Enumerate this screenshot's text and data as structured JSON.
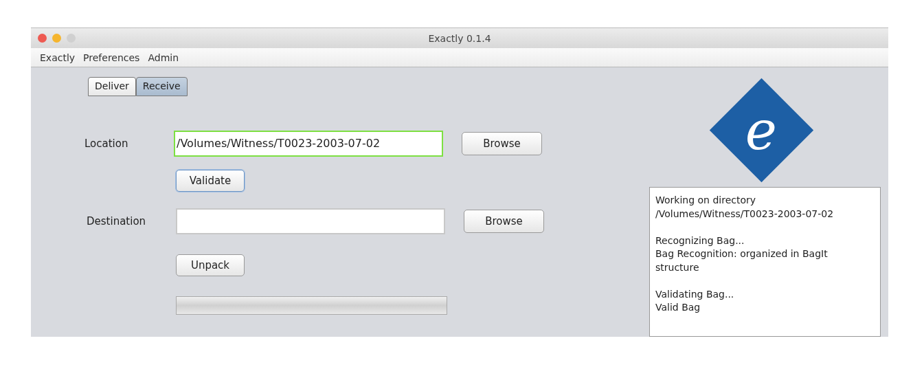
{
  "window": {
    "title": "Exactly 0.1.4"
  },
  "menu": [
    "Exactly",
    "Preferences",
    "Admin"
  ],
  "tabs": [
    {
      "label": "Deliver",
      "selected": false
    },
    {
      "label": "Receive",
      "selected": true
    }
  ],
  "rows": [
    {
      "kind": "field",
      "label": "Location",
      "value": "/Volumes/Witness/T0023-2003-07-02",
      "highlighted": true,
      "button": "Browse"
    },
    {
      "kind": "button",
      "label": "Validate",
      "focused": true
    },
    {
      "kind": "field",
      "label": "Destination",
      "value": "",
      "highlighted": false,
      "button": "Browse"
    },
    {
      "kind": "button",
      "label": "Unpack",
      "focused": false
    },
    {
      "kind": "progress",
      "level": 0
    }
  ],
  "logo": {
    "letter": "e"
  },
  "log": [
    [
      "Working on directory",
      "/Volumes/Witness/T0023-2003-07-02"
    ],
    [
      "Recognizing Bag...",
      "Bag Recognition: organized in BagIt structure"
    ],
    [
      "Validating Bag...",
      "Valid Bag"
    ]
  ]
}
